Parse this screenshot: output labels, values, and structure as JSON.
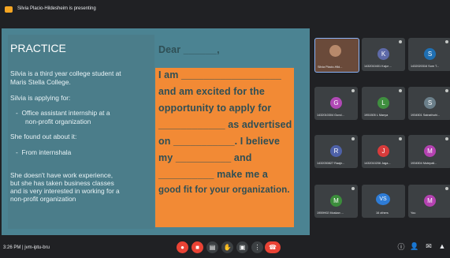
{
  "header": {
    "presenter_text": "Silvia Placio-Hildesheim is presenting"
  },
  "slide": {
    "title": "PRACTICE",
    "left_paragraphs": [
      "Silvia is a third year college student at",
      "Maris Stella College.",
      "Silvia is applying for:",
      "Office assistant internship at a",
      "non-profit organization",
      "She found out about it:",
      "From internshala",
      "She doesn't have work experience,",
      "but she has taken business classes",
      "and is very interested in working for a",
      "non-profit organization"
    ],
    "letter_lines": [
      "Dear ______,",
      "I am __________________",
      "and am excited for the",
      "opportunity to apply for",
      "____________ as advertised",
      "on ___________. I believe",
      "my __________ and",
      "__________ make me a",
      "good fit for your organization."
    ]
  },
  "participants": [
    {
      "name": "Silvia Placio-Hild...",
      "initial": "",
      "color": "#6a4a3a"
    },
    {
      "name": "1432010401 Kajur ...",
      "initial": "K",
      "color": "#5e6aa8"
    },
    {
      "name": "1432020316 Som T...",
      "initial": "S",
      "color": "#1f6fb2"
    },
    {
      "name": "1432010304 Gund...",
      "initial": "G",
      "color": "#b049b5"
    },
    {
      "name": "1951505 L Manya",
      "initial": "L",
      "color": "#3f8f3f"
    },
    {
      "name": "1934501 Sainathuhi...",
      "initial": "S",
      "color": "#6b7f8a"
    },
    {
      "name": "1432030827 Raajn...",
      "initial": "R",
      "color": "#4e61a8"
    },
    {
      "name": "1432010206 Jaga...",
      "initial": "J",
      "color": "#d83b3b"
    },
    {
      "name": "1934504 Mutepali...",
      "initial": "M",
      "color": "#b442b1"
    },
    {
      "name": "1959H02 Muskan ...",
      "initial": "M",
      "color": "#3b8d3b"
    },
    {
      "name": "16 others",
      "initial": "VS",
      "color": "#2e7cd6"
    },
    {
      "name": "You",
      "initial": "M",
      "color": "#b442b1"
    }
  ],
  "bottombar": {
    "time_text": "3:26 PM | jvm-iptu-bru"
  },
  "controls": [
    {
      "name": "mic-off-button",
      "icon": "mic-off-icon",
      "color": "#ea4335"
    },
    {
      "name": "camera-off-button",
      "icon": "camera-off-icon",
      "color": "#ea4335"
    },
    {
      "name": "captions-button",
      "icon": "captions-icon",
      "color": "#3c4043"
    },
    {
      "name": "raise-hand-button",
      "icon": "hand-icon",
      "color": "#3c4043"
    },
    {
      "name": "present-button",
      "icon": "present-icon",
      "color": "#3c4043"
    },
    {
      "name": "more-options-button",
      "icon": "more-icon",
      "color": "#3c4043"
    }
  ]
}
